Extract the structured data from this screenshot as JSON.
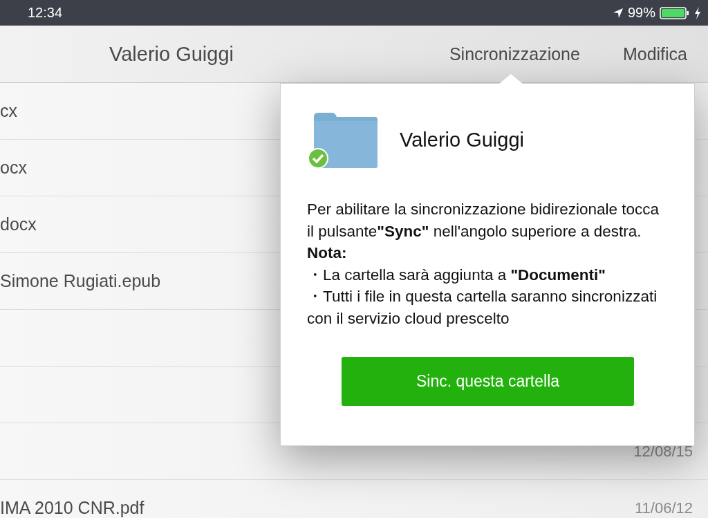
{
  "status_bar": {
    "time": "12:34",
    "battery": "99%"
  },
  "nav_bar": {
    "title": "Valerio Guiggi",
    "buttons": [
      "Sincronizzazione",
      "Modifica"
    ]
  },
  "files": [
    {
      "kind": "file",
      "name": "cx"
    },
    {
      "kind": "file",
      "name": "ocx"
    },
    {
      "kind": "file",
      "name": "docx"
    },
    {
      "kind": "file",
      "name": "Simone Rugiati.epub"
    },
    {
      "kind": "blank"
    },
    {
      "kind": "blank"
    },
    {
      "kind": "file",
      "date": "12/08/15"
    },
    {
      "kind": "file",
      "name": "IMA 2010 CNR.pdf",
      "date": "11/06/12"
    }
  ],
  "popover": {
    "folder_name": "Valerio Guiggi",
    "synced": true,
    "message": "Per abilitare la sincronizzazione bidirezionale tocca il pulsante**\"Sync\"** nell'angolo superiore a destra.",
    "note_label": "Nota:",
    "notes": [
      "・La cartella sarà aggiunta a **\"Documenti\"**",
      "・Tutti i file in questa cartella saranno sincronizzati con il servizio cloud prescelto"
    ],
    "button": "Sinc. questa cartella"
  }
}
